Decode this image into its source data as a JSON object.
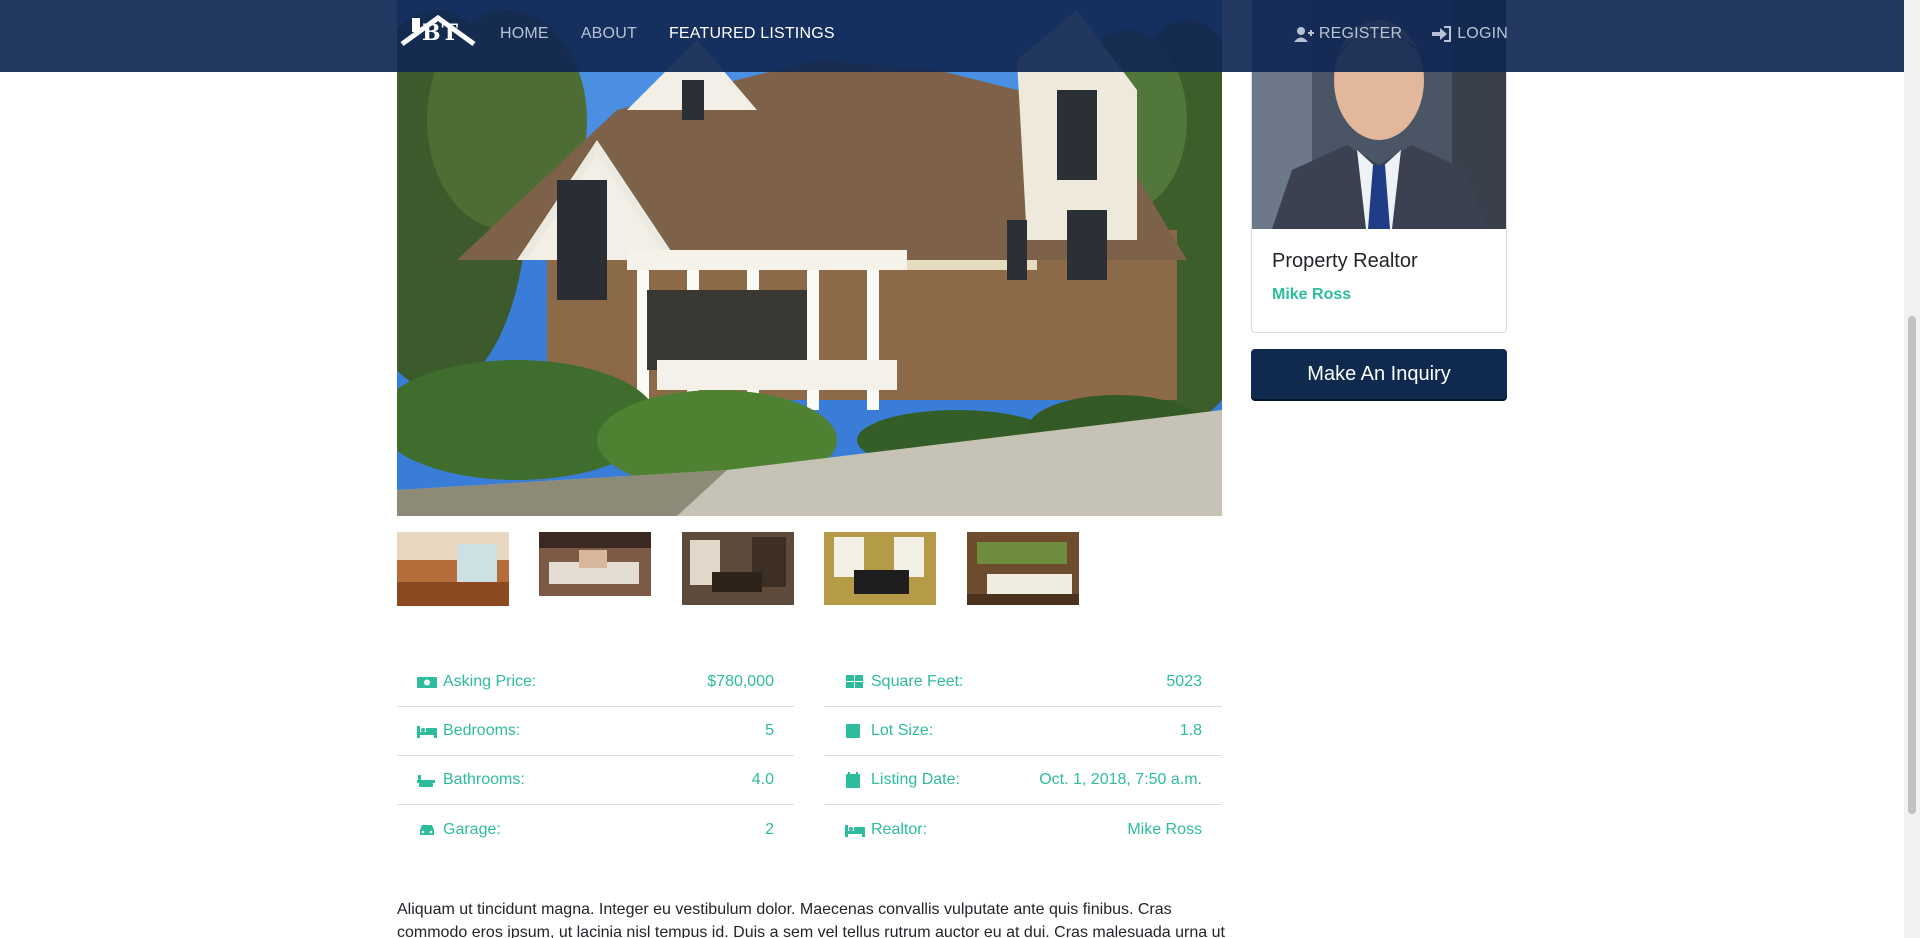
{
  "nav": {
    "brand": "BT",
    "links": [
      "HOME",
      "ABOUT",
      "FEATURED LISTINGS"
    ],
    "register": "REGISTER",
    "login": "LOGIN"
  },
  "colors": {
    "navbar": "#102752",
    "accent": "#2ebc9f",
    "button": "#10294f"
  },
  "listing": {
    "thumbnails": [
      "kitchen-photo",
      "living-room-photo",
      "dining-room-photo",
      "game-room-photo",
      "lounge-photo"
    ],
    "left": [
      {
        "icon": "money-icon",
        "label": "Asking Price:",
        "value": "$780,000"
      },
      {
        "icon": "bed-icon",
        "label": "Bedrooms:",
        "value": "5"
      },
      {
        "icon": "bath-icon",
        "label": "Bathrooms:",
        "value": "4.0"
      },
      {
        "icon": "car-icon",
        "label": "Garage:",
        "value": "2"
      }
    ],
    "right": [
      {
        "icon": "grid-icon",
        "label": "Square Feet:",
        "value": "5023"
      },
      {
        "icon": "square-icon",
        "label": "Lot Size:",
        "value": "1.8"
      },
      {
        "icon": "calendar-icon",
        "label": "Listing Date:",
        "value": "Oct. 1, 2018, 7:50 a.m."
      },
      {
        "icon": "bed-icon",
        "label": "Realtor:",
        "value": "Mike Ross"
      }
    ],
    "description": "Aliquam ut tincidunt magna. Integer eu vestibulum dolor. Maecenas convallis vulputate ante quis finibus. Cras commodo eros ipsum, ut lacinia nisl tempus id. Duis a sem vel tellus rutrum auctor eu at dui. Cras malesuada urna ut"
  },
  "sidebar": {
    "title": "Property Realtor",
    "realtor_name": "Mike Ross",
    "inquiry_button": "Make An Inquiry"
  }
}
